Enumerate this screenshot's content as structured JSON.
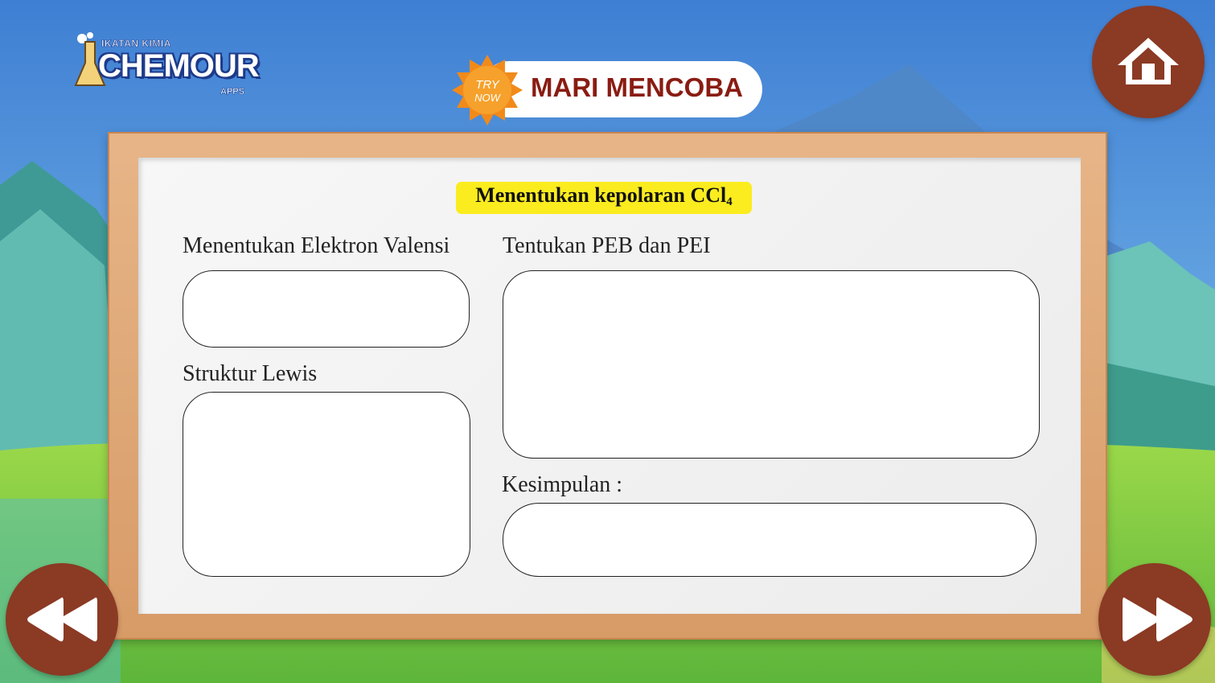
{
  "logo": {
    "small_text": "IKATAN KIMIA",
    "brand": "CHEMOUR",
    "sub_text": "APPS"
  },
  "header": {
    "badge_line1": "TRY",
    "badge_line2": "NOW",
    "title": "MARI MENCOBA"
  },
  "nav": {
    "home_icon": "home-icon",
    "prev_icon": "rewind-icon",
    "next_icon": "fast-forward-icon"
  },
  "board": {
    "task_title": "Menentukan kepolaran CCl",
    "task_title_subscript": "4",
    "labels": {
      "valence": "Menentukan Elektron Valensi",
      "peb_pei": "Tentukan PEB dan PEI",
      "lewis": "Struktur Lewis",
      "conclusion": "Kesimpulan :"
    }
  },
  "colors": {
    "button": "#8b3a24",
    "title_text": "#8a1c12",
    "highlight": "#fbec1f",
    "frame": "#dba06b"
  }
}
